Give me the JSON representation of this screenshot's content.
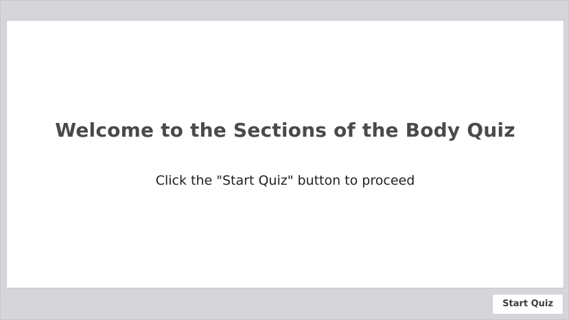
{
  "slide": {
    "title": "Welcome to the Sections of the Body Quiz",
    "subtitle": "Click the \"Start Quiz\" button to proceed"
  },
  "footer": {
    "start_label": "Start Quiz"
  },
  "colors": {
    "background": "#d6d5da",
    "slide_background": "#ffffff",
    "title_text": "#4a4a4a",
    "body_text": "#1f1f1f"
  }
}
